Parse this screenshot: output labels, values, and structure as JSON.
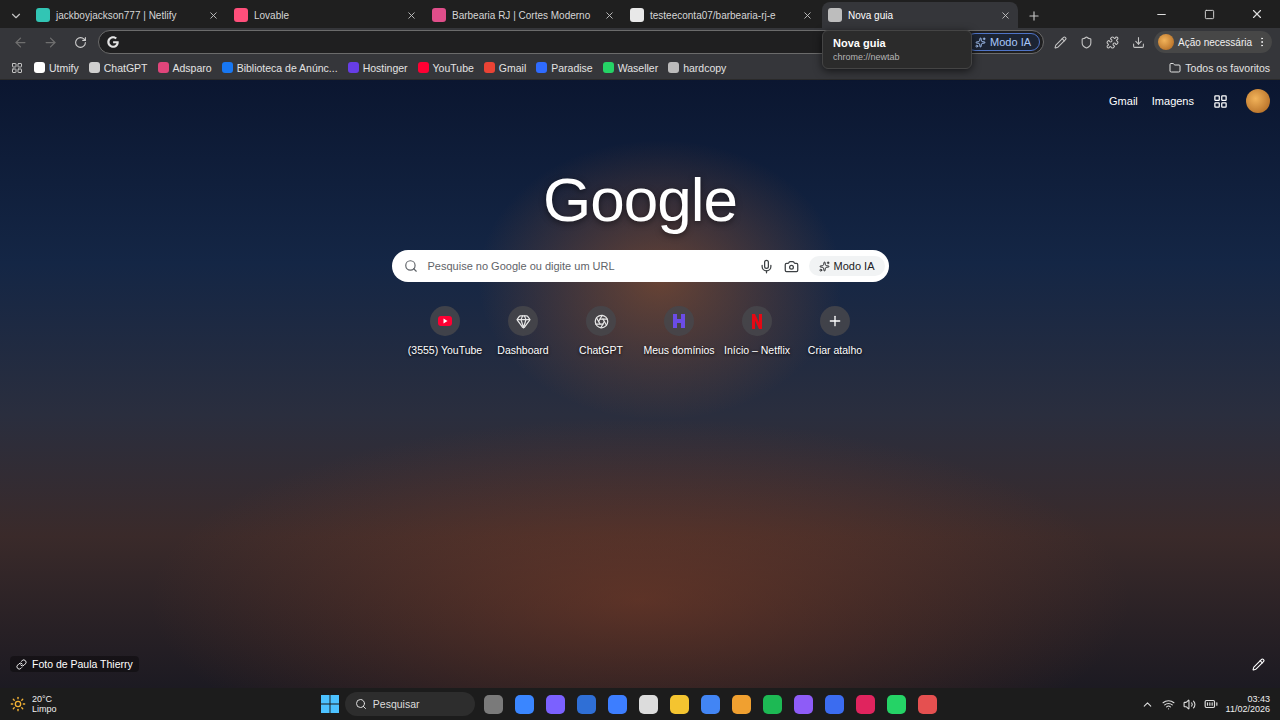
{
  "tabs": [
    {
      "title": "jackboyjackson777 | Netlify",
      "selected": false,
      "color": "#32c5b4"
    },
    {
      "title": "Lovable",
      "selected": false,
      "color": "#ff4f7b"
    },
    {
      "title": "Barbearia RJ | Cortes Moderno",
      "selected": false,
      "color": "#e04e8a"
    },
    {
      "title": "testeeconta07/barbearia-rj-e",
      "selected": false,
      "color": "#e8e8e8"
    },
    {
      "title": "Nova guia",
      "selected": true,
      "color": "#bdbdbd"
    }
  ],
  "tooltip": {
    "title": "Nova guia",
    "url": "chrome://newtab"
  },
  "address_bar": {
    "ai_button": "Modo IA"
  },
  "profile_button": "Ação necessária",
  "bookmarks": [
    {
      "label": "Utmify",
      "color": "#ffffff"
    },
    {
      "label": "ChatGPT",
      "color": "#cfcfcf"
    },
    {
      "label": "Adsparo",
      "color": "#e0457b"
    },
    {
      "label": "Biblioteca de Anúnc...",
      "color": "#1877f2"
    },
    {
      "label": "Hostinger",
      "color": "#673de6"
    },
    {
      "label": "YouTube",
      "color": "#ff0033"
    },
    {
      "label": "Gmail",
      "color": "#ea4335"
    },
    {
      "label": "Paradise",
      "color": "#2f6bff"
    },
    {
      "label": "Waseller",
      "color": "#25d366"
    },
    {
      "label": "hardcopy",
      "color": "#bbbbbb"
    }
  ],
  "all_bookmarks": "Todos os favoritos",
  "top_links": [
    "Gmail",
    "Imagens"
  ],
  "logo": "Google",
  "search": {
    "placeholder": "Pesquise no Google ou digite um URL",
    "ai_button": "Modo IA"
  },
  "shortcuts": [
    {
      "label": "(3555) YouTube",
      "kind": "site",
      "color": "#ff0033"
    },
    {
      "label": "Dashboard",
      "kind": "site",
      "color": "#e6e6e6"
    },
    {
      "label": "ChatGPT",
      "kind": "site",
      "color": "#e6e6e6"
    },
    {
      "label": "Meus domínios",
      "kind": "site",
      "color": "#6b4ce6"
    },
    {
      "label": "Início – Netflix",
      "kind": "site",
      "color": "#e50914"
    },
    {
      "label": "Criar atalho",
      "kind": "add",
      "color": "#ffffff"
    }
  ],
  "photo_credit": "Foto de Paula Thierry",
  "taskbar": {
    "weather": {
      "temp": "20°C",
      "condition": "Limpo"
    },
    "search": "Pesquisar",
    "apps": [
      {
        "color": "#7a7a7a"
      },
      {
        "color": "#3a86ff"
      },
      {
        "color": "#7b61ff"
      },
      {
        "color": "#2f6fd6"
      },
      {
        "color": "#3d7eff"
      },
      {
        "color": "#dcdcdc"
      },
      {
        "color": "#f4c430"
      },
      {
        "color": "#4285f4"
      },
      {
        "color": "#f0a030"
      },
      {
        "color": "#1db954"
      },
      {
        "color": "#8e5cf7"
      },
      {
        "color": "#3b6cf0"
      },
      {
        "color": "#e0245e"
      },
      {
        "color": "#25d366"
      },
      {
        "color": "#e55050"
      }
    ],
    "clock": {
      "time": "03:43",
      "date": "11/02/2026"
    }
  }
}
